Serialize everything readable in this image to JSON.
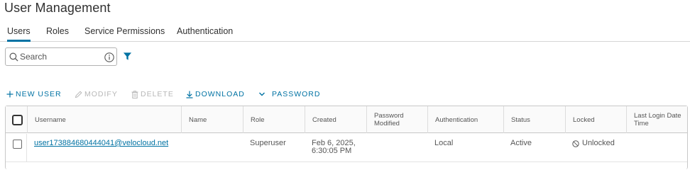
{
  "page": {
    "title": "User Management"
  },
  "tabs": [
    {
      "label": "Users",
      "active": true
    },
    {
      "label": "Roles",
      "active": false
    },
    {
      "label": "Service Permissions",
      "active": false
    },
    {
      "label": "Authentication",
      "active": false
    }
  ],
  "search": {
    "placeholder": "Search",
    "value": ""
  },
  "icons": {
    "search": "search-icon",
    "info": "info-icon",
    "filter": "filter-icon",
    "plus": "plus-icon",
    "pencil": "pencil-icon",
    "trash": "trash-icon",
    "download": "download-icon",
    "chevron": "chevron-down-icon",
    "unlocked": "unlocked-circle-icon"
  },
  "toolbar": {
    "new_user": "NEW USER",
    "modify": "MODIFY",
    "delete": "DELETE",
    "download": "DOWNLOAD",
    "password": "PASSWORD"
  },
  "table": {
    "columns": [
      "Username",
      "Name",
      "Role",
      "Created",
      "Password Modified",
      "Authentication",
      "Status",
      "Locked",
      "Last Login Date Time"
    ],
    "rows": [
      {
        "username": "user173884680444041@velocloud.net",
        "name": "",
        "role": "Superuser",
        "created": "Feb 6, 2025, 6:30:05 PM",
        "password_modified": "",
        "authentication": "Local",
        "status": "Active",
        "locked": "Unlocked",
        "last_login": ""
      }
    ]
  },
  "colors": {
    "accent": "#0072a3",
    "text": "#313131",
    "disabled": "#b7b7b7",
    "border": "#c8c8c8"
  }
}
